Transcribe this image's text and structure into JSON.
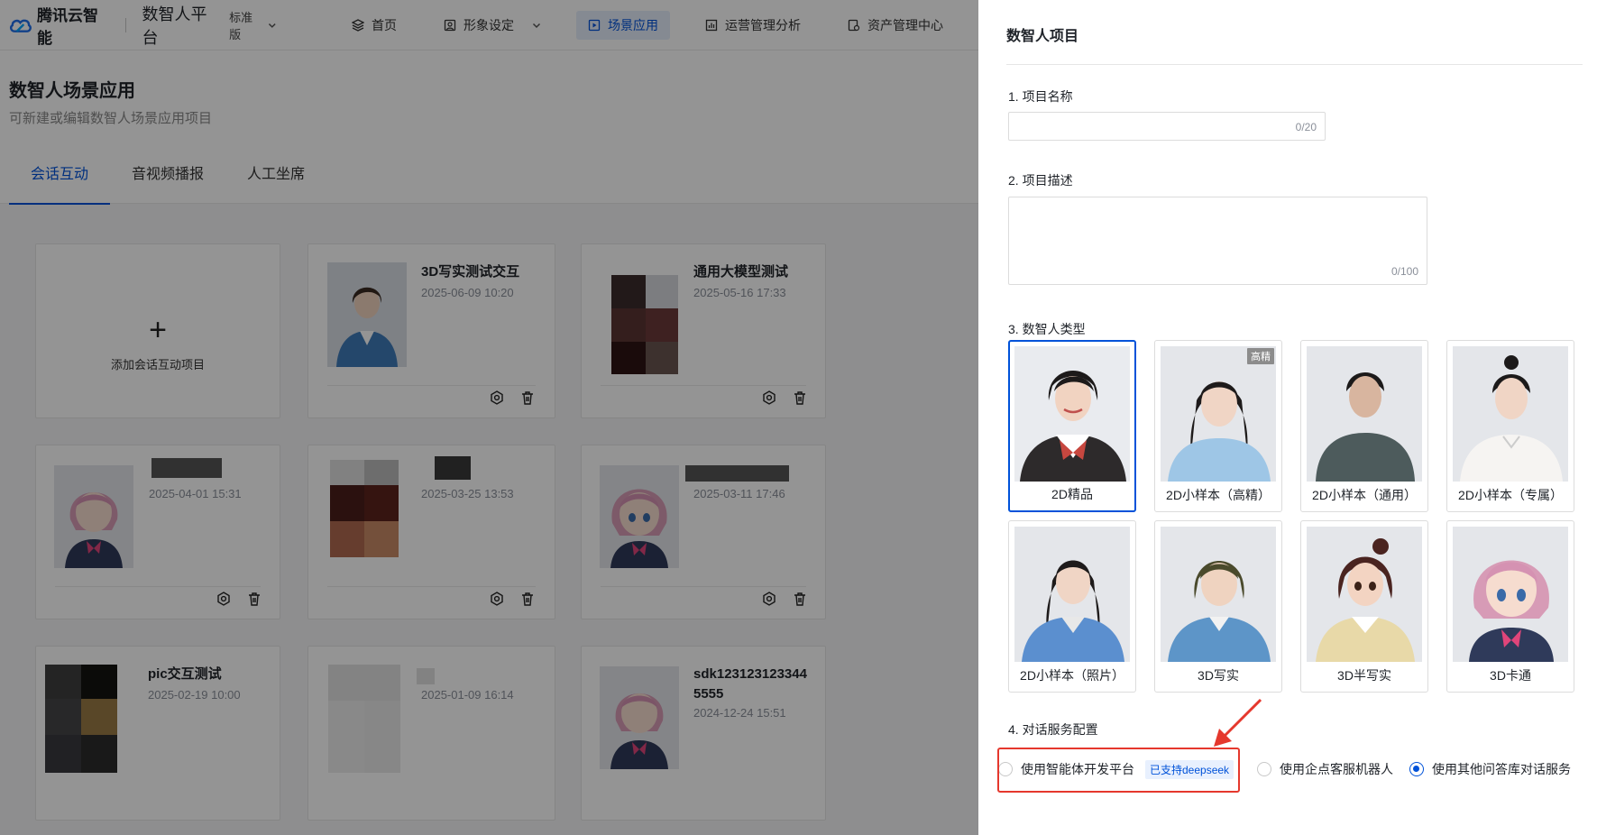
{
  "header": {
    "logo_text": "腾讯云智能",
    "platform": "数智人平台",
    "edition": "标准版",
    "nav": [
      {
        "label": "首页",
        "icon": "layers-icon"
      },
      {
        "label": "形象设定",
        "icon": "portrait-icon"
      },
      {
        "label": "场景应用",
        "icon": "play-icon",
        "active": true
      },
      {
        "label": "运营管理分析",
        "icon": "chart-icon"
      },
      {
        "label": "资产管理中心",
        "icon": "asset-icon"
      }
    ]
  },
  "page": {
    "title": "数智人场景应用",
    "subtitle": "可新建或编辑数智人场景应用项目",
    "tabs": [
      "会话互动",
      "音视频播报",
      "人工坐席"
    ]
  },
  "cards": {
    "add_label": "添加会话互动项目",
    "items": [
      {
        "name": "3D写实测试交互",
        "time": "2025-06-09 10:20"
      },
      {
        "name": "通用大模型测试",
        "time": "2025-05-16 17:33"
      },
      {
        "name": "",
        "time": "2025-04-01 15:31"
      },
      {
        "name": "",
        "time": "2025-03-25 13:53"
      },
      {
        "name": "",
        "time": "2025-03-11 17:46"
      },
      {
        "name": "pic交互测试",
        "time": "2025-02-19 10:00"
      },
      {
        "name": "",
        "time": "2025-01-09 16:14"
      },
      {
        "name": "sdk1231231233445555",
        "time": "2024-12-24 15:51"
      }
    ]
  },
  "drawer": {
    "title": "数智人项目",
    "f1_label": "1. 项目名称",
    "f1_count": "0/20",
    "f2_label": "2. 项目描述",
    "f2_count": "0/100",
    "f3_label": "3. 数智人类型",
    "avatars": [
      {
        "label": "2D精品",
        "selected": true
      },
      {
        "label": "2D小样本（高精）",
        "badge": "高精"
      },
      {
        "label": "2D小样本（通用）"
      },
      {
        "label": "2D小样本（专属）"
      },
      {
        "label": "2D小样本（照片）"
      },
      {
        "label": "3D写实"
      },
      {
        "label": "3D半写实"
      },
      {
        "label": "3D卡通"
      }
    ],
    "f4_label": "4. 对话服务配置",
    "options": [
      {
        "label": "使用智能体开发平台",
        "badge": "已支持deepseek",
        "checked": false
      },
      {
        "label": "使用企点客服机器人",
        "checked": false
      },
      {
        "label": "使用其他问答库对话服务",
        "checked": true
      }
    ]
  }
}
